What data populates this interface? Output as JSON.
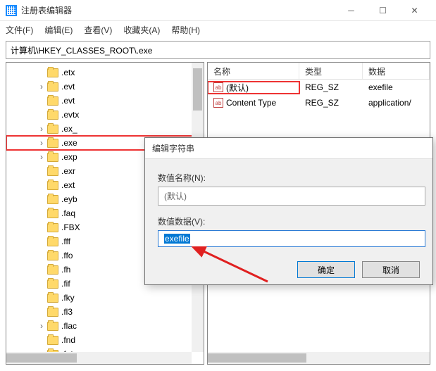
{
  "window": {
    "title": "注册表编辑器"
  },
  "menu": {
    "file": "文件(F)",
    "edit": "编辑(E)",
    "view": "查看(V)",
    "favorites": "收藏夹(A)",
    "help": "帮助(H)"
  },
  "address": "计算机\\HKEY_CLASSES_ROOT\\.exe",
  "tree": {
    "items": [
      {
        "label": ".etx",
        "expandable": false
      },
      {
        "label": ".evt",
        "expandable": true
      },
      {
        "label": ".evt",
        "expandable": false
      },
      {
        "label": ".evtx",
        "expandable": false
      },
      {
        "label": ".ex_",
        "expandable": true
      },
      {
        "label": ".exe",
        "expandable": true,
        "highlight": true
      },
      {
        "label": ".exp",
        "expandable": true
      },
      {
        "label": ".exr",
        "expandable": false
      },
      {
        "label": ".ext",
        "expandable": false
      },
      {
        "label": ".eyb",
        "expandable": false
      },
      {
        "label": ".faq",
        "expandable": false
      },
      {
        "label": ".FBX",
        "expandable": false
      },
      {
        "label": ".fff",
        "expandable": false
      },
      {
        "label": ".ffo",
        "expandable": false
      },
      {
        "label": ".fh",
        "expandable": false
      },
      {
        "label": ".fif",
        "expandable": false
      },
      {
        "label": ".fky",
        "expandable": false
      },
      {
        "label": ".fl3",
        "expandable": false
      },
      {
        "label": ".flac",
        "expandable": true
      },
      {
        "label": ".fnd",
        "expandable": false
      },
      {
        "label": ".fnt",
        "expandable": false
      }
    ]
  },
  "list": {
    "headers": {
      "name": "名称",
      "type": "类型",
      "data": "数据"
    },
    "rows": [
      {
        "name": "(默认)",
        "type": "REG_SZ",
        "data": "exefile",
        "highlight": true
      },
      {
        "name": "Content Type",
        "type": "REG_SZ",
        "data": "application/"
      }
    ]
  },
  "dialog": {
    "title": "编辑字符串",
    "name_label": "数值名称(N):",
    "name_value": "(默认)",
    "data_label": "数值数据(V):",
    "data_value": "exefile",
    "ok": "确定",
    "cancel": "取消"
  }
}
